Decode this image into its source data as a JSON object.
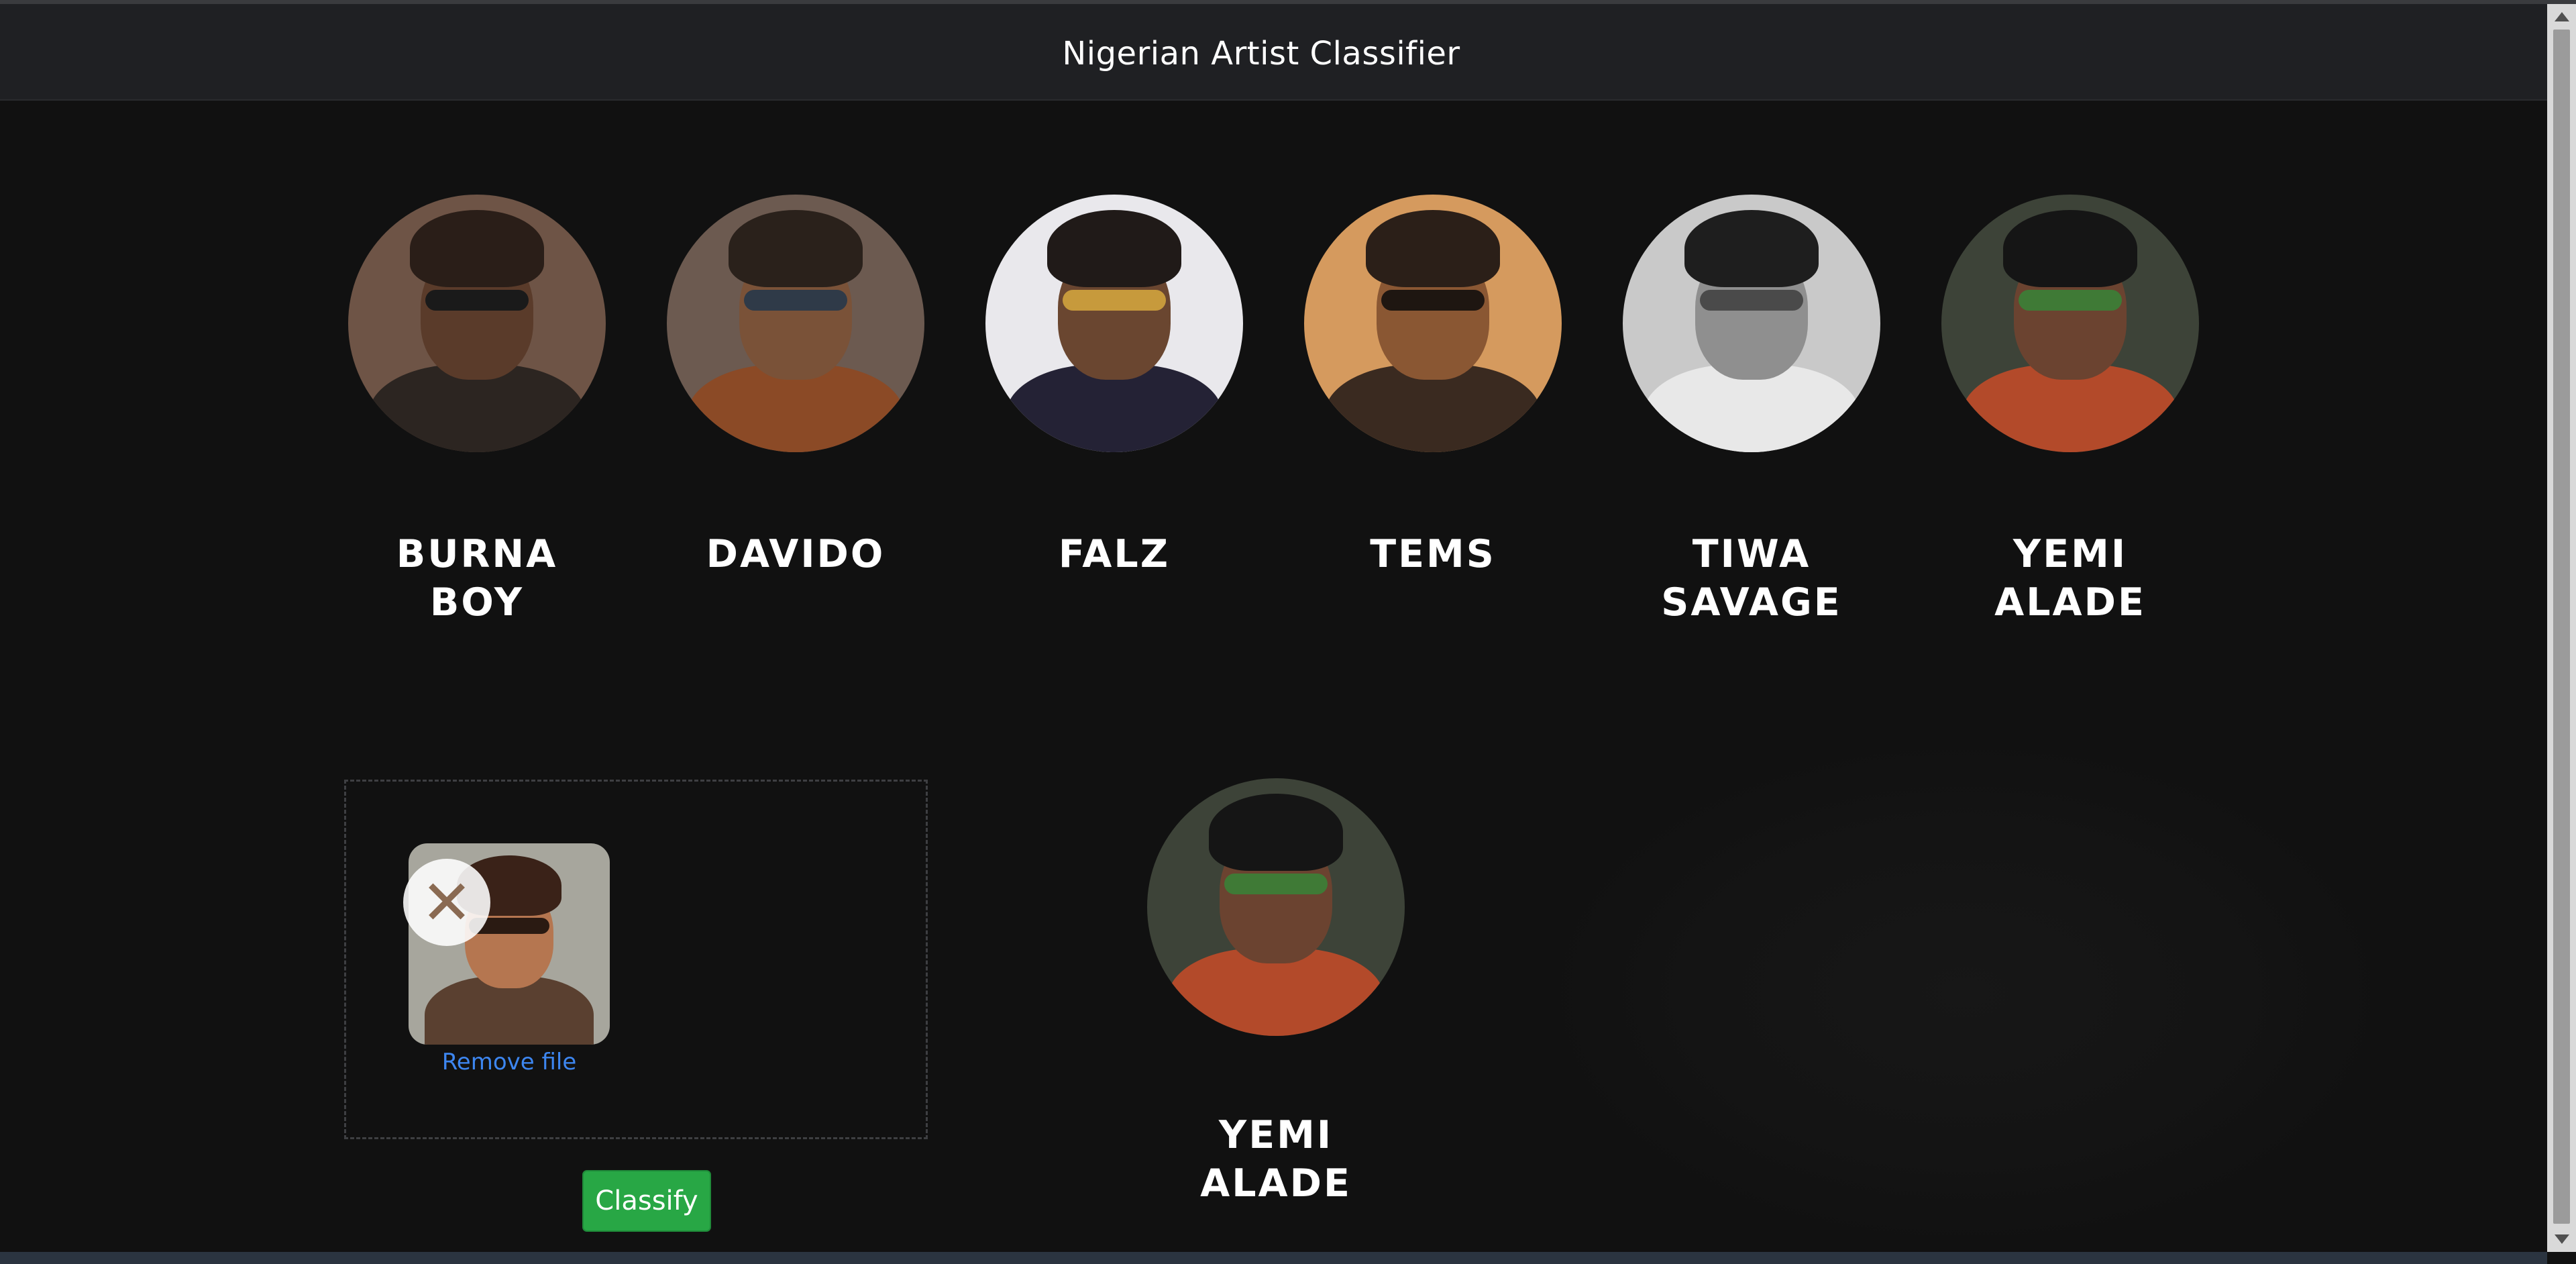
{
  "app": {
    "title": "Nigerian Artist Classifier"
  },
  "artists": [
    {
      "name_lines": [
        "BURNA",
        "BOY"
      ],
      "photo": {
        "bg": "#6e5446",
        "skin": "#5a3b2a",
        "hair": "#2a1e18",
        "cloth": "#2c2521",
        "accent": "#1a1a1a"
      }
    },
    {
      "name_lines": [
        "DAVIDO"
      ],
      "photo": {
        "bg": "#6c5a50",
        "skin": "#7a5238",
        "hair": "#2a211b",
        "cloth": "#8b4a26",
        "accent": "#2f3a48"
      }
    },
    {
      "name_lines": [
        "FALZ"
      ],
      "photo": {
        "bg": "#e9e8ec",
        "skin": "#6a4630",
        "hair": "#201a18",
        "cloth": "#242235",
        "accent": "#c79a3c"
      }
    },
    {
      "name_lines": [
        "TEMS"
      ],
      "photo": {
        "bg": "#d59a5e",
        "skin": "#8a5733",
        "hair": "#2b1f18",
        "cloth": "#3a2a20",
        "accent": "#1e1611"
      }
    },
    {
      "name_lines": [
        "TIWA",
        "SAVAGE"
      ],
      "photo": {
        "bg": "#c9c9c9",
        "skin": "#8f8f8f",
        "hair": "#1e1e1e",
        "cloth": "#e8e8e8",
        "accent": "#4a4a4a"
      }
    },
    {
      "name_lines": [
        "YEMI",
        "ALADE"
      ],
      "photo": {
        "bg": "#3d4338",
        "skin": "#6b4330",
        "hair": "#151515",
        "cloth": "#b34a2a",
        "accent": "#3f7a36"
      }
    }
  ],
  "upload": {
    "remove_label": "Remove file",
    "remove_glyph": "✕",
    "classify_label": "Classify",
    "preview_photo": {
      "bg": "#a7a69d",
      "skin": "#b57650",
      "hair": "#3a2218",
      "cloth": "#5a4030",
      "accent": "#2a1a12"
    }
  },
  "result": {
    "name": "YEMI ALADE",
    "photo": {
      "bg": "#3d4338",
      "skin": "#6b4330",
      "hair": "#151515",
      "cloth": "#b34a2a",
      "accent": "#3f7a36"
    }
  },
  "colors": {
    "background": "#111111",
    "navbar": "#1f2023",
    "classify_button": "#28a745",
    "link": "#3d86f0"
  }
}
